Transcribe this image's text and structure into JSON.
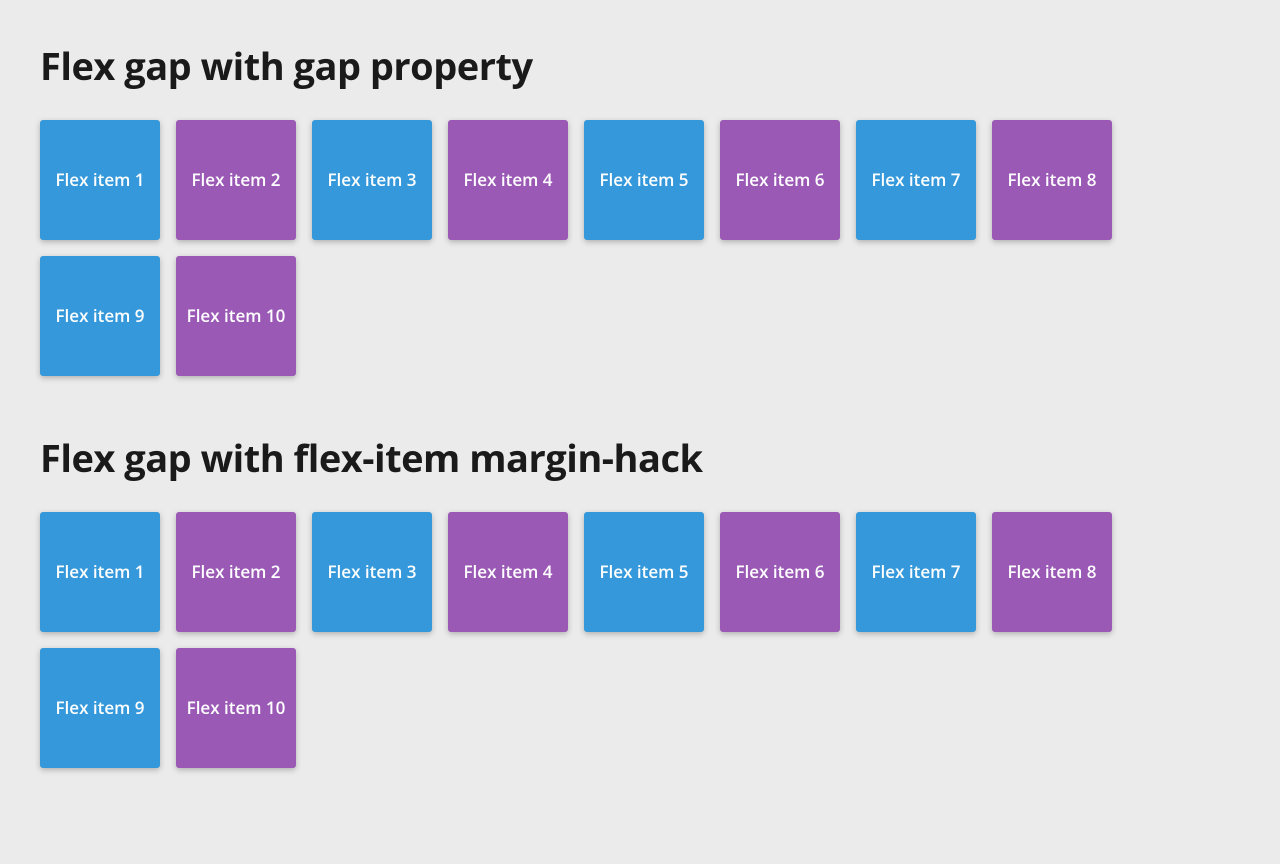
{
  "colors": {
    "blue": "#3498db",
    "purple": "#9b59b6",
    "bg": "#ebebeb"
  },
  "sections": [
    {
      "heading": "Flex gap with gap property",
      "items": [
        {
          "label": "Flex item 1",
          "color": "blue"
        },
        {
          "label": "Flex item 2",
          "color": "purple"
        },
        {
          "label": "Flex item 3",
          "color": "blue"
        },
        {
          "label": "Flex item 4",
          "color": "purple"
        },
        {
          "label": "Flex item 5",
          "color": "blue"
        },
        {
          "label": "Flex item 6",
          "color": "purple"
        },
        {
          "label": "Flex item 7",
          "color": "blue"
        },
        {
          "label": "Flex item 8",
          "color": "purple"
        },
        {
          "label": "Flex item 9",
          "color": "blue"
        },
        {
          "label": "Flex item 10",
          "color": "purple"
        }
      ]
    },
    {
      "heading": "Flex gap with flex-item margin-hack",
      "items": [
        {
          "label": "Flex item 1",
          "color": "blue"
        },
        {
          "label": "Flex item 2",
          "color": "purple"
        },
        {
          "label": "Flex item 3",
          "color": "blue"
        },
        {
          "label": "Flex item 4",
          "color": "purple"
        },
        {
          "label": "Flex item 5",
          "color": "blue"
        },
        {
          "label": "Flex item 6",
          "color": "purple"
        },
        {
          "label": "Flex item 7",
          "color": "blue"
        },
        {
          "label": "Flex item 8",
          "color": "purple"
        },
        {
          "label": "Flex item 9",
          "color": "blue"
        },
        {
          "label": "Flex item 10",
          "color": "purple"
        }
      ]
    }
  ]
}
